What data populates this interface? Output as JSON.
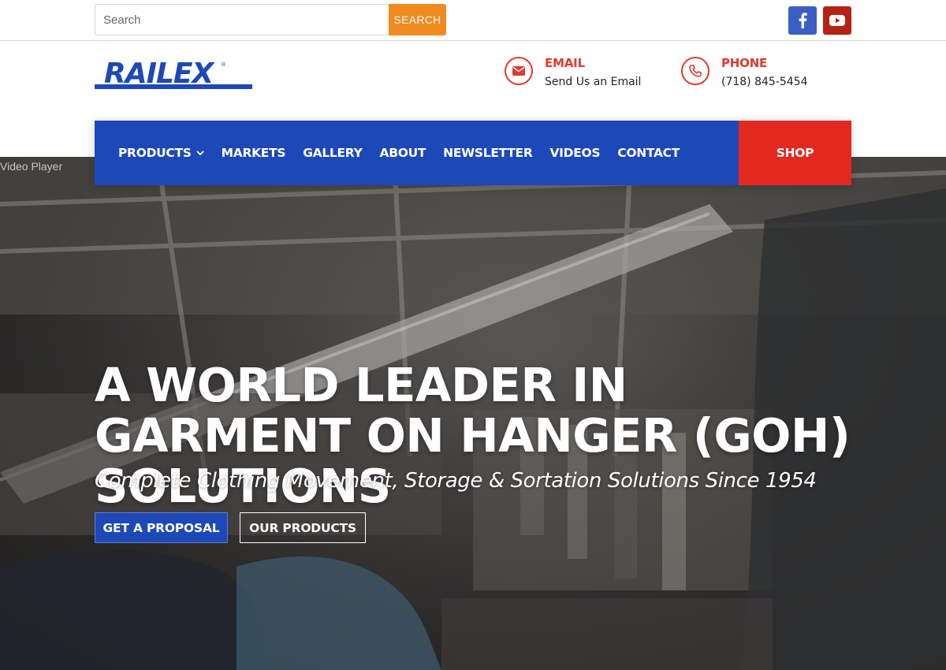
{
  "topbar": {
    "search": {
      "placeholder": "Search",
      "button_label": "SEARCH"
    },
    "social": [
      {
        "icon": "facebook-icon",
        "color": "#3b5ec4"
      },
      {
        "icon": "youtube-icon",
        "color": "#b52314"
      }
    ]
  },
  "header": {
    "logo_text": "RAILEX",
    "contacts": [
      {
        "icon": "envelope-icon",
        "title": "EMAIL",
        "value": "Send Us an Email"
      },
      {
        "icon": "phone-icon",
        "title": "PHONE",
        "value": "(718) 845-5454"
      }
    ],
    "accent_color": "#e03a2f"
  },
  "nav": {
    "items": [
      {
        "label": "PRODUCTS",
        "has_dropdown": true
      },
      {
        "label": "MARKETS"
      },
      {
        "label": "GALLERY"
      },
      {
        "label": "ABOUT"
      },
      {
        "label": "NEWSLETTER"
      },
      {
        "label": "VIDEOS"
      },
      {
        "label": "CONTACT"
      }
    ],
    "shop_label": "SHOP",
    "nav_color": "#1d48b7",
    "shop_color": "#e3281f"
  },
  "hero": {
    "video_label": "Video Player",
    "title": "A WORLD LEADER IN GARMENT ON HANGER (GOH) SOLUTIONS",
    "subtitle": "Complete Clothing Movement, Storage & Sortation Solutions Since 1954",
    "primary_button": "GET A PROPOSAL",
    "secondary_button": "OUR PRODUCTS"
  }
}
